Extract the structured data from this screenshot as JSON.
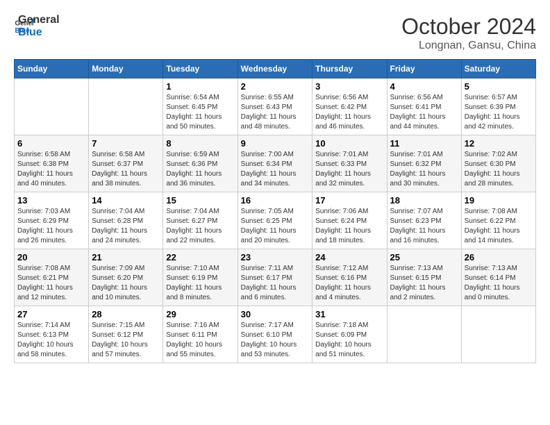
{
  "header": {
    "logo_line1": "General",
    "logo_line2": "Blue",
    "month": "October 2024",
    "location": "Longnan, Gansu, China"
  },
  "weekdays": [
    "Sunday",
    "Monday",
    "Tuesday",
    "Wednesday",
    "Thursday",
    "Friday",
    "Saturday"
  ],
  "weeks": [
    [
      {
        "day": "",
        "sunrise": "",
        "sunset": "",
        "daylight": ""
      },
      {
        "day": "",
        "sunrise": "",
        "sunset": "",
        "daylight": ""
      },
      {
        "day": "1",
        "sunrise": "Sunrise: 6:54 AM",
        "sunset": "Sunset: 6:45 PM",
        "daylight": "Daylight: 11 hours and 50 minutes."
      },
      {
        "day": "2",
        "sunrise": "Sunrise: 6:55 AM",
        "sunset": "Sunset: 6:43 PM",
        "daylight": "Daylight: 11 hours and 48 minutes."
      },
      {
        "day": "3",
        "sunrise": "Sunrise: 6:56 AM",
        "sunset": "Sunset: 6:42 PM",
        "daylight": "Daylight: 11 hours and 46 minutes."
      },
      {
        "day": "4",
        "sunrise": "Sunrise: 6:56 AM",
        "sunset": "Sunset: 6:41 PM",
        "daylight": "Daylight: 11 hours and 44 minutes."
      },
      {
        "day": "5",
        "sunrise": "Sunrise: 6:57 AM",
        "sunset": "Sunset: 6:39 PM",
        "daylight": "Daylight: 11 hours and 42 minutes."
      }
    ],
    [
      {
        "day": "6",
        "sunrise": "Sunrise: 6:58 AM",
        "sunset": "Sunset: 6:38 PM",
        "daylight": "Daylight: 11 hours and 40 minutes."
      },
      {
        "day": "7",
        "sunrise": "Sunrise: 6:58 AM",
        "sunset": "Sunset: 6:37 PM",
        "daylight": "Daylight: 11 hours and 38 minutes."
      },
      {
        "day": "8",
        "sunrise": "Sunrise: 6:59 AM",
        "sunset": "Sunset: 6:36 PM",
        "daylight": "Daylight: 11 hours and 36 minutes."
      },
      {
        "day": "9",
        "sunrise": "Sunrise: 7:00 AM",
        "sunset": "Sunset: 6:34 PM",
        "daylight": "Daylight: 11 hours and 34 minutes."
      },
      {
        "day": "10",
        "sunrise": "Sunrise: 7:01 AM",
        "sunset": "Sunset: 6:33 PM",
        "daylight": "Daylight: 11 hours and 32 minutes."
      },
      {
        "day": "11",
        "sunrise": "Sunrise: 7:01 AM",
        "sunset": "Sunset: 6:32 PM",
        "daylight": "Daylight: 11 hours and 30 minutes."
      },
      {
        "day": "12",
        "sunrise": "Sunrise: 7:02 AM",
        "sunset": "Sunset: 6:30 PM",
        "daylight": "Daylight: 11 hours and 28 minutes."
      }
    ],
    [
      {
        "day": "13",
        "sunrise": "Sunrise: 7:03 AM",
        "sunset": "Sunset: 6:29 PM",
        "daylight": "Daylight: 11 hours and 26 minutes."
      },
      {
        "day": "14",
        "sunrise": "Sunrise: 7:04 AM",
        "sunset": "Sunset: 6:28 PM",
        "daylight": "Daylight: 11 hours and 24 minutes."
      },
      {
        "day": "15",
        "sunrise": "Sunrise: 7:04 AM",
        "sunset": "Sunset: 6:27 PM",
        "daylight": "Daylight: 11 hours and 22 minutes."
      },
      {
        "day": "16",
        "sunrise": "Sunrise: 7:05 AM",
        "sunset": "Sunset: 6:25 PM",
        "daylight": "Daylight: 11 hours and 20 minutes."
      },
      {
        "day": "17",
        "sunrise": "Sunrise: 7:06 AM",
        "sunset": "Sunset: 6:24 PM",
        "daylight": "Daylight: 11 hours and 18 minutes."
      },
      {
        "day": "18",
        "sunrise": "Sunrise: 7:07 AM",
        "sunset": "Sunset: 6:23 PM",
        "daylight": "Daylight: 11 hours and 16 minutes."
      },
      {
        "day": "19",
        "sunrise": "Sunrise: 7:08 AM",
        "sunset": "Sunset: 6:22 PM",
        "daylight": "Daylight: 11 hours and 14 minutes."
      }
    ],
    [
      {
        "day": "20",
        "sunrise": "Sunrise: 7:08 AM",
        "sunset": "Sunset: 6:21 PM",
        "daylight": "Daylight: 11 hours and 12 minutes."
      },
      {
        "day": "21",
        "sunrise": "Sunrise: 7:09 AM",
        "sunset": "Sunset: 6:20 PM",
        "daylight": "Daylight: 11 hours and 10 minutes."
      },
      {
        "day": "22",
        "sunrise": "Sunrise: 7:10 AM",
        "sunset": "Sunset: 6:19 PM",
        "daylight": "Daylight: 11 hours and 8 minutes."
      },
      {
        "day": "23",
        "sunrise": "Sunrise: 7:11 AM",
        "sunset": "Sunset: 6:17 PM",
        "daylight": "Daylight: 11 hours and 6 minutes."
      },
      {
        "day": "24",
        "sunrise": "Sunrise: 7:12 AM",
        "sunset": "Sunset: 6:16 PM",
        "daylight": "Daylight: 11 hours and 4 minutes."
      },
      {
        "day": "25",
        "sunrise": "Sunrise: 7:13 AM",
        "sunset": "Sunset: 6:15 PM",
        "daylight": "Daylight: 11 hours and 2 minutes."
      },
      {
        "day": "26",
        "sunrise": "Sunrise: 7:13 AM",
        "sunset": "Sunset: 6:14 PM",
        "daylight": "Daylight: 11 hours and 0 minutes."
      }
    ],
    [
      {
        "day": "27",
        "sunrise": "Sunrise: 7:14 AM",
        "sunset": "Sunset: 6:13 PM",
        "daylight": "Daylight: 10 hours and 58 minutes."
      },
      {
        "day": "28",
        "sunrise": "Sunrise: 7:15 AM",
        "sunset": "Sunset: 6:12 PM",
        "daylight": "Daylight: 10 hours and 57 minutes."
      },
      {
        "day": "29",
        "sunrise": "Sunrise: 7:16 AM",
        "sunset": "Sunset: 6:11 PM",
        "daylight": "Daylight: 10 hours and 55 minutes."
      },
      {
        "day": "30",
        "sunrise": "Sunrise: 7:17 AM",
        "sunset": "Sunset: 6:10 PM",
        "daylight": "Daylight: 10 hours and 53 minutes."
      },
      {
        "day": "31",
        "sunrise": "Sunrise: 7:18 AM",
        "sunset": "Sunset: 6:09 PM",
        "daylight": "Daylight: 10 hours and 51 minutes."
      },
      {
        "day": "",
        "sunrise": "",
        "sunset": "",
        "daylight": ""
      },
      {
        "day": "",
        "sunrise": "",
        "sunset": "",
        "daylight": ""
      }
    ]
  ]
}
